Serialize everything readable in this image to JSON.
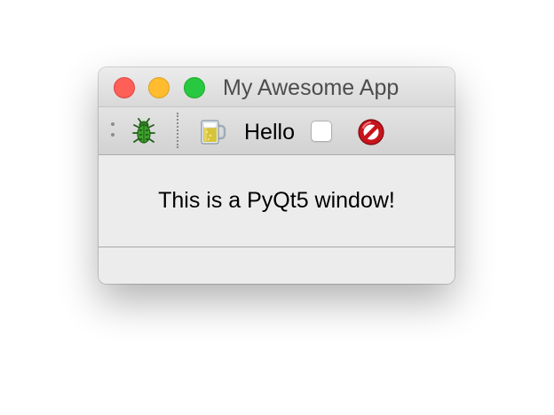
{
  "window": {
    "title": "My Awesome App"
  },
  "toolbar": {
    "tools": [
      {
        "icon": "bug-icon"
      },
      {
        "icon": "beer-icon"
      },
      {
        "icon": "stop-icon"
      }
    ],
    "checkbox_label": "Hello",
    "checkbox_checked": false
  },
  "content": {
    "label": "This is a PyQt5 window!"
  },
  "colors": {
    "close": "#fe5f57",
    "minimize": "#febc2e",
    "zoom": "#28c840"
  }
}
